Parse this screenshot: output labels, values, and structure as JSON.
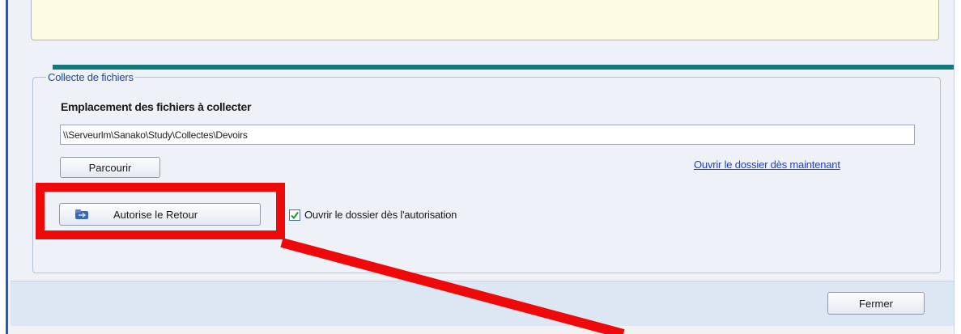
{
  "group": {
    "title": "Collecte de fichiers",
    "field_label": "Emplacement des fichiers à collecter",
    "path_value": "\\\\Serveurlm\\Sanako\\Study\\Collectes\\Devoirs"
  },
  "buttons": {
    "browse": "Parcourir",
    "authorize": "Autorise le Retour",
    "close": "Fermer"
  },
  "link": {
    "open_folder_now": "Ouvrir le dossier dès maintenant"
  },
  "checkbox": {
    "label": "Ouvrir le dossier dès l'autorisation",
    "checked": true
  },
  "icons": {
    "authorize": "return-folder-icon",
    "checkmark": "checkmark-icon"
  },
  "colors": {
    "annotation_red": "#ee0a0a",
    "teal_line": "#127a7e",
    "link_blue": "#1c3fd1",
    "group_title": "#1e46a8"
  }
}
